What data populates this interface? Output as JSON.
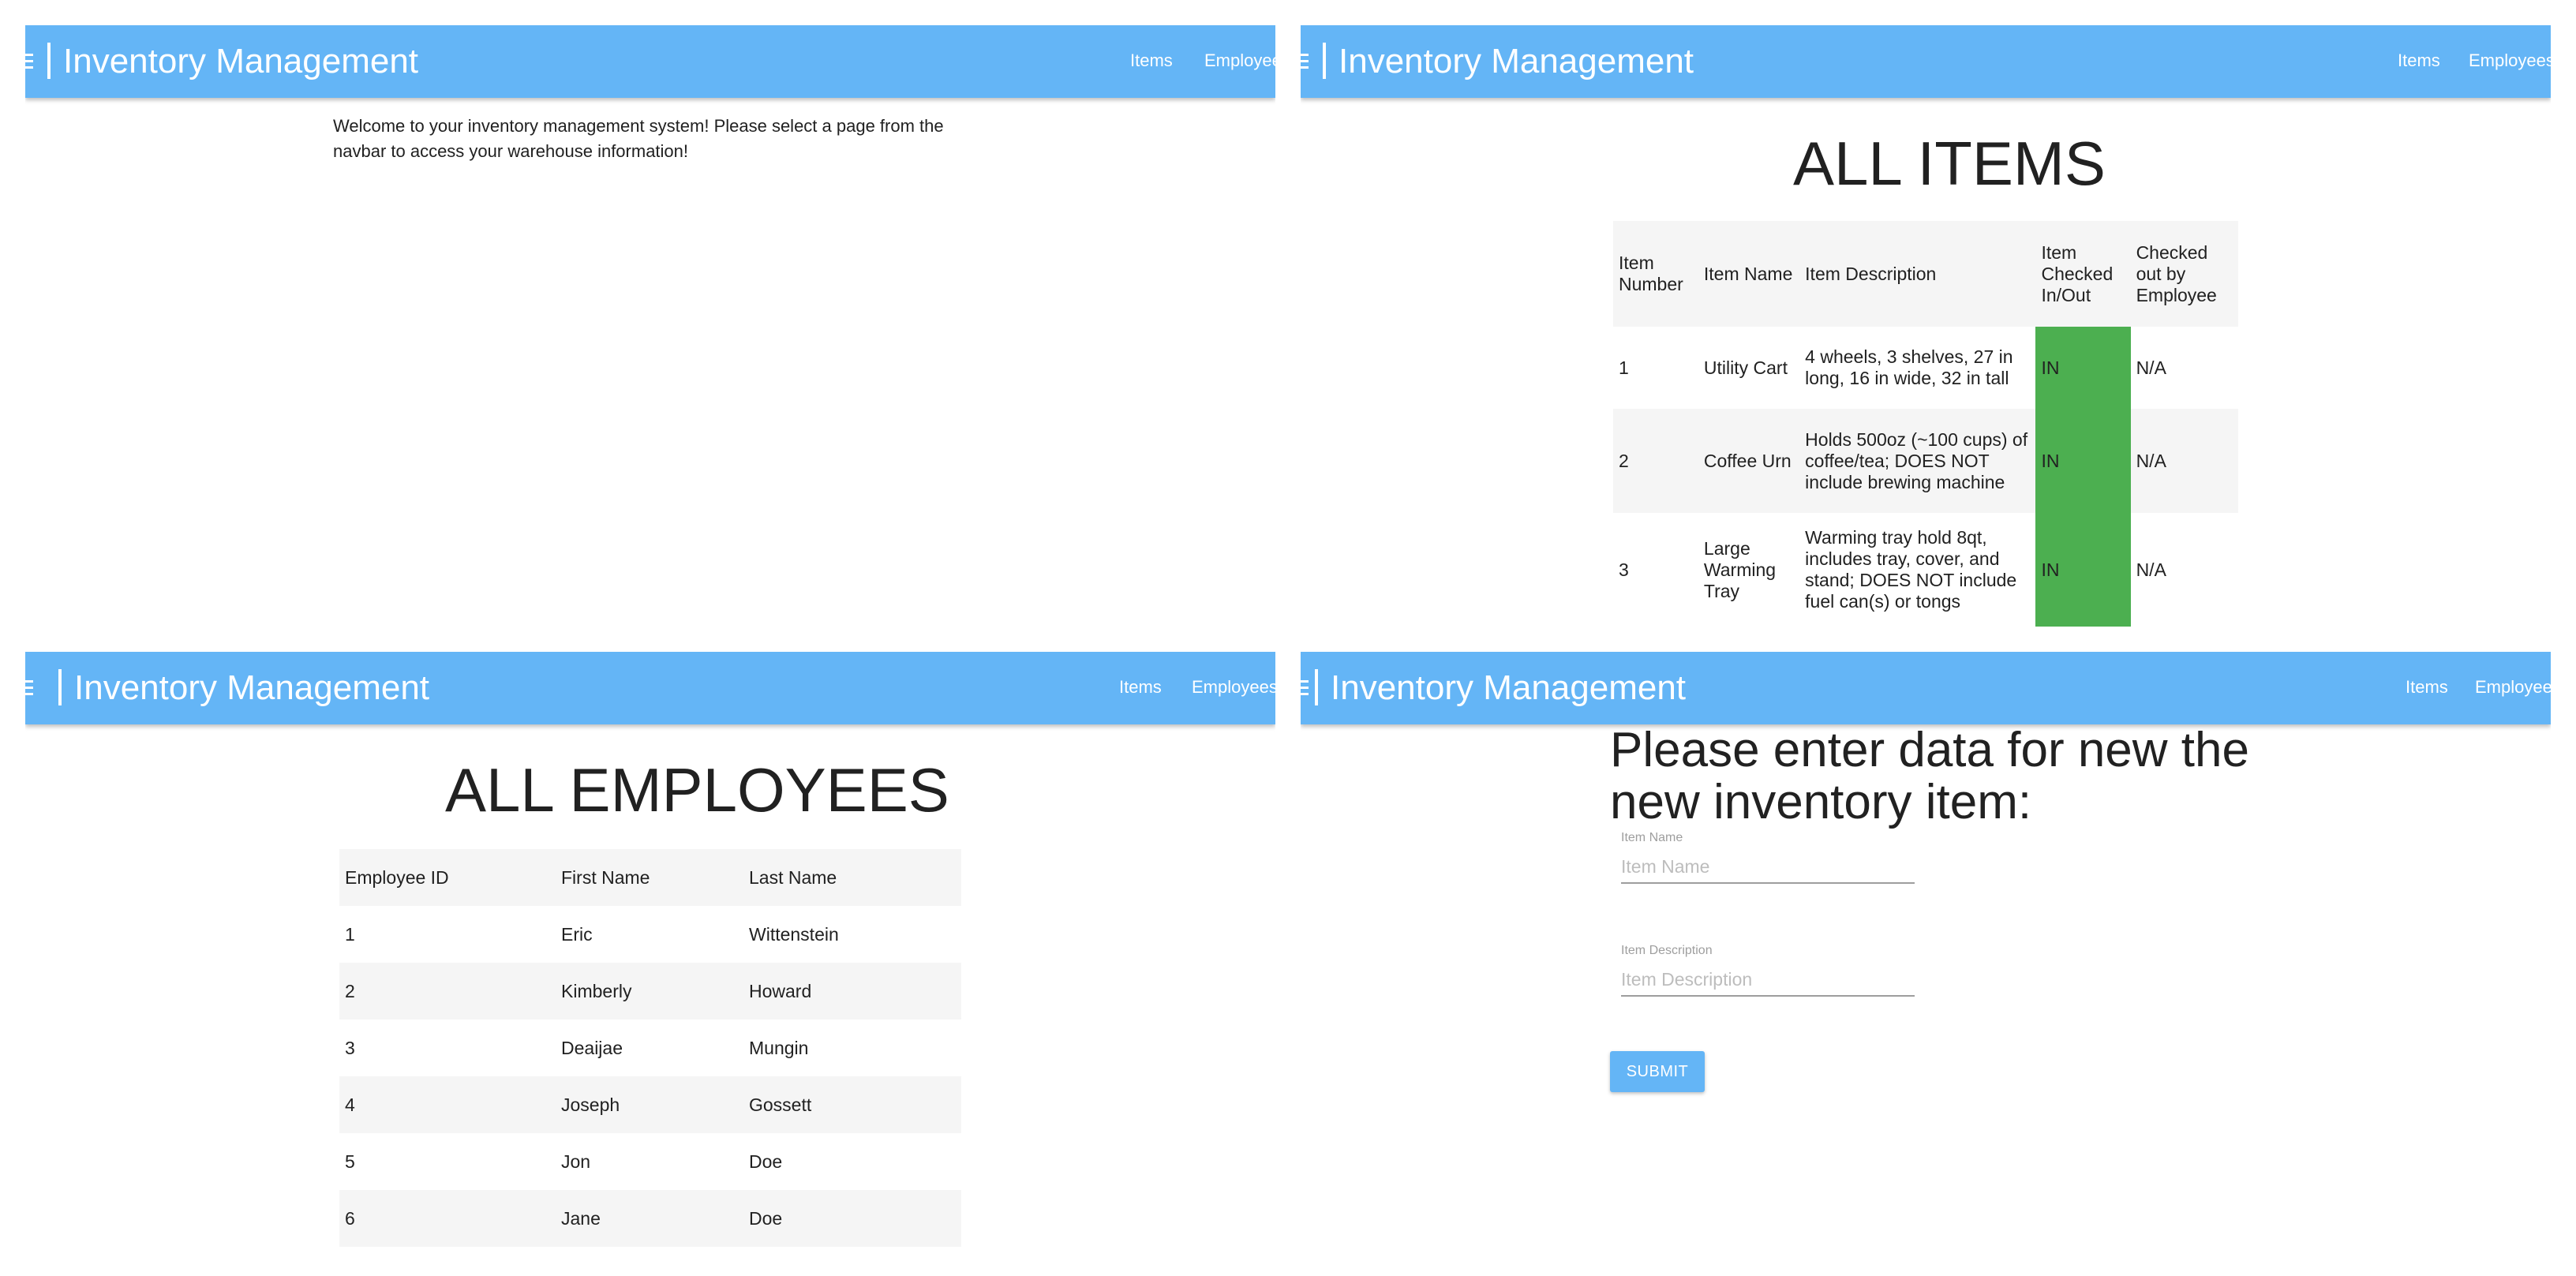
{
  "navbar": {
    "title": "Inventory Management",
    "items_link": "Items",
    "employees_link": "Employees",
    "icon": "inventory-icon"
  },
  "home": {
    "welcome_text": "Welcome to your inventory management system! Please select a page from the navbar to access your warehouse information!"
  },
  "items_page": {
    "heading": "ALL ITEMS",
    "columns": {
      "number": "Item Number",
      "name": "Item Name",
      "description": "Item Description",
      "status": "Item Checked In/Out",
      "employee": "Checked out by Employee"
    },
    "rows": [
      {
        "number": "1",
        "name": "Utility Cart",
        "description": "4 wheels, 3 shelves, 27 in long, 16 in wide, 32 in tall",
        "status": "IN",
        "employee": "N/A"
      },
      {
        "number": "2",
        "name": "Coffee Urn",
        "description": "Holds 500oz (~100 cups) of coffee/tea; DOES NOT include brewing machine",
        "status": "IN",
        "employee": "N/A"
      },
      {
        "number": "3",
        "name": "Large Warming Tray",
        "description": "Warming tray hold 8qt, includes tray, cover, and stand; DOES NOT include fuel can(s) or tongs",
        "status": "IN",
        "employee": "N/A"
      }
    ],
    "status_in_color": "#4caf50"
  },
  "employees_page": {
    "heading": "ALL EMPLOYEES",
    "columns": {
      "id": "Employee ID",
      "first": "First Name",
      "last": "Last Name"
    },
    "rows": [
      {
        "id": "1",
        "first": "Eric",
        "last": "Wittenstein"
      },
      {
        "id": "2",
        "first": "Kimberly",
        "last": "Howard"
      },
      {
        "id": "3",
        "first": "Deaijae",
        "last": "Mungin"
      },
      {
        "id": "4",
        "first": "Joseph",
        "last": "Gossett"
      },
      {
        "id": "5",
        "first": "Jon",
        "last": "Doe"
      },
      {
        "id": "6",
        "first": "Jane",
        "last": "Doe"
      }
    ]
  },
  "form_page": {
    "heading": "Please enter data for new the new inventory item:",
    "name_label": "Item Name",
    "name_placeholder": "Item Name",
    "description_label": "Item Description",
    "description_placeholder": "Item Description",
    "submit_label": "SUBMIT"
  },
  "colors": {
    "navbar": "#64b5f6",
    "row_alt": "#f5f5f5"
  }
}
